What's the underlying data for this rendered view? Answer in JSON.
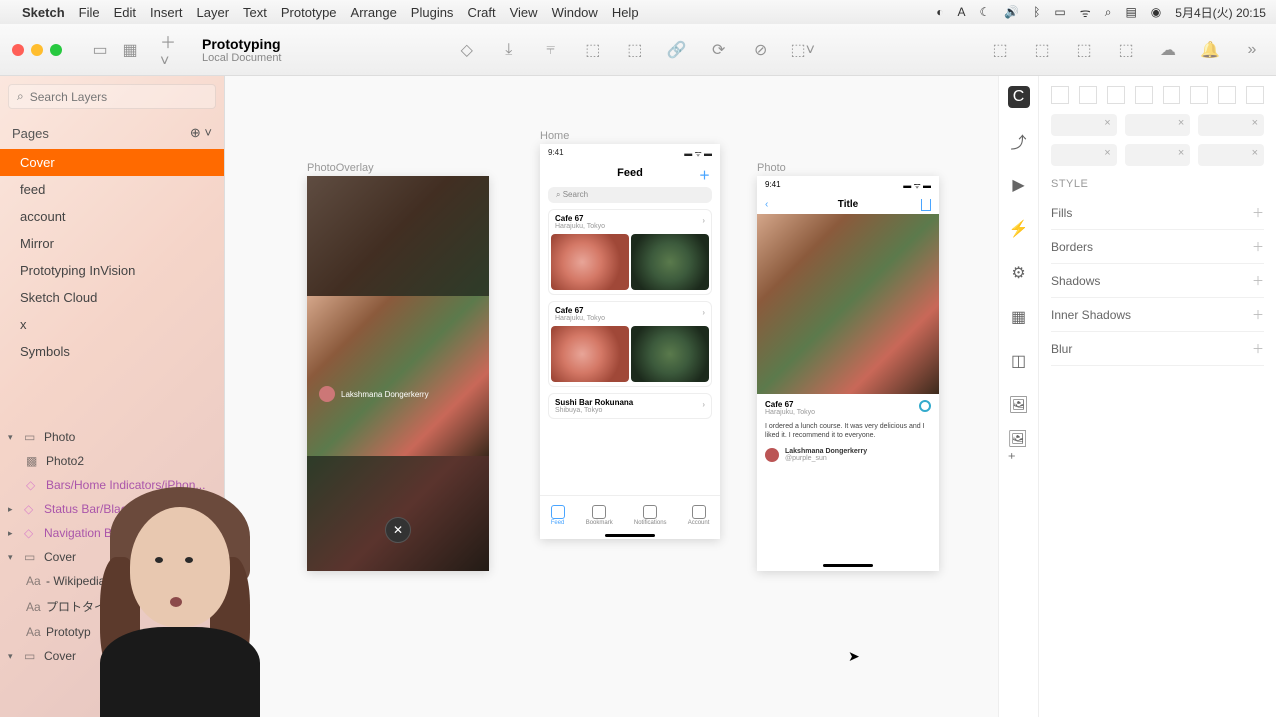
{
  "menubar": {
    "app": "Sketch",
    "items": [
      "File",
      "Edit",
      "Insert",
      "Layer",
      "Text",
      "Prototype",
      "Arrange",
      "Plugins",
      "Craft",
      "View",
      "Window",
      "Help"
    ],
    "clock": "5月4日(火) 20:15"
  },
  "toolbar": {
    "title": "Prototyping",
    "subtitle": "Local Document"
  },
  "leftpanel": {
    "search_placeholder": "Search Layers",
    "pages_label": "Pages",
    "pages": [
      {
        "name": "Cover",
        "active": true
      },
      {
        "name": "feed"
      },
      {
        "name": "account"
      },
      {
        "name": "Mirror"
      },
      {
        "name": "Prototyping InVision"
      },
      {
        "name": "Sketch Cloud"
      },
      {
        "name": "x"
      },
      {
        "name": "Symbols"
      }
    ],
    "layers": [
      {
        "name": "Photo",
        "type": "artboard",
        "indent": 0,
        "open": true
      },
      {
        "name": "Photo2",
        "type": "image",
        "indent": 1
      },
      {
        "name": "Bars/Home Indicators/iPhon...",
        "type": "symbol",
        "indent": 1
      },
      {
        "name": "Status Bar/Black/100%",
        "type": "symbol",
        "indent": 0,
        "open": false,
        "chev": true
      },
      {
        "name": "Navigation Bar/St...",
        "type": "symbol",
        "indent": 0,
        "open": false,
        "chev": true
      },
      {
        "name": "Cover",
        "type": "artboard",
        "indent": 0,
        "open": true
      },
      {
        "name": "- Wikipedia",
        "type": "text",
        "indent": 1
      },
      {
        "name": "プロトタイピ",
        "type": "text",
        "indent": 1
      },
      {
        "name": "Prototyp",
        "type": "text",
        "indent": 1
      },
      {
        "name": "Cover",
        "type": "artboard",
        "indent": 0,
        "open": true,
        "last": true
      }
    ]
  },
  "canvas": {
    "artboards": {
      "overlay": {
        "label": "PhotoOverlay",
        "author": "Lakshmana Dongerkerry"
      },
      "home": {
        "label": "Home",
        "time": "9:41",
        "title": "Feed",
        "search": "Search",
        "cards": [
          {
            "title": "Cafe 67",
            "sub": "Harajuku, Tokyo"
          },
          {
            "title": "Cafe 67",
            "sub": "Harajuku, Tokyo"
          },
          {
            "title": "Sushi Bar Rokunana",
            "sub": "Shibuya, Tokyo"
          }
        ],
        "tabs": [
          "Feed",
          "Bookmark",
          "Notifications",
          "Account"
        ]
      },
      "photo": {
        "label": "Photo",
        "time": "9:41",
        "navtitle": "Title",
        "name": "Cafe 67",
        "loc": "Harajuku, Tokyo",
        "desc": "I ordered a lunch course. It was very delicious and I liked it. I recommend it to everyone.",
        "author": "Lakshmana Dongerkerry",
        "handle": "@purple_sun"
      }
    }
  },
  "inspector": {
    "style_label": "STYLE",
    "props": [
      "Fills",
      "Borders",
      "Shadows",
      "Inner Shadows",
      "Blur"
    ]
  }
}
